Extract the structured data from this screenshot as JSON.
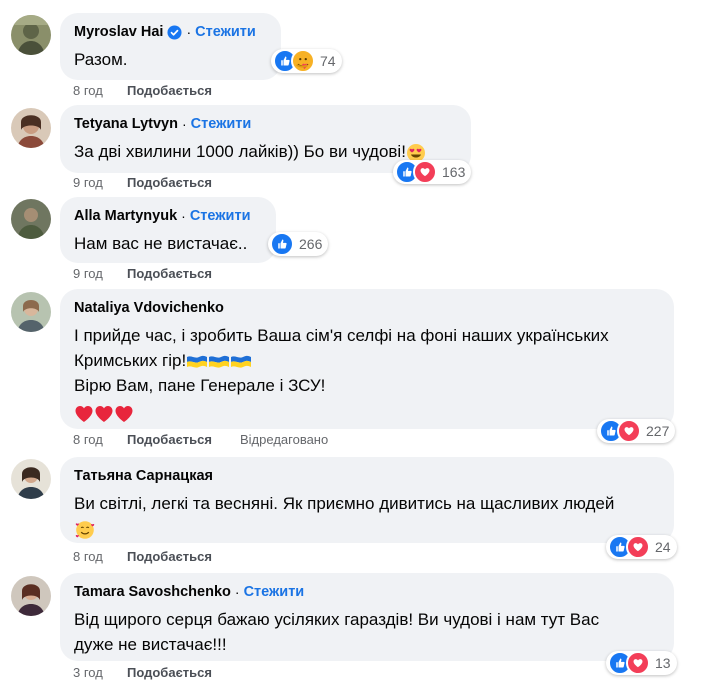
{
  "follow_label": "Стежити",
  "like_label": "Подобається",
  "comments": [
    {
      "author": "Myroslav Hai",
      "verified": true,
      "show_follow": true,
      "text": "Разом.",
      "time": "8 год",
      "reactions": [
        "like",
        "care"
      ],
      "reaction_count": "74"
    },
    {
      "author": "Tetyana Lytvyn",
      "verified": false,
      "show_follow": true,
      "text": "За дві хвилини 1000 лайків)) Бо ви чудові!",
      "trailing_emoji": "heart-eyes",
      "time": "9 год",
      "reactions": [
        "like",
        "love"
      ],
      "reaction_count": "163"
    },
    {
      "author": "Alla Martynyuk",
      "verified": false,
      "show_follow": true,
      "text": "Нам вас не вистачає..",
      "time": "9 год",
      "reactions": [
        "like"
      ],
      "reaction_count": "266"
    },
    {
      "author": "Nataliya Vdovichenko",
      "verified": false,
      "show_follow": false,
      "text_lines": [
        "І прийде час, і зробить Ваша сім'я селфі на фоні наших українських",
        "Кримських гір!",
        "Вірю Вам, пане Генерале і ЗСУ!"
      ],
      "flags": [
        "ukraine-flag",
        "ukraine-flag",
        "ukraine-flag"
      ],
      "hearts": [
        "red-heart",
        "red-heart",
        "red-heart"
      ],
      "time": "8 год",
      "edited": "Відредаговано",
      "reactions": [
        "like",
        "love"
      ],
      "reaction_count": "227"
    },
    {
      "author": "Татьяна Сарнацкая",
      "verified": false,
      "show_follow": false,
      "text": "Ви світлі, легкі та весняні. Як приємно дивитись на щасливих людей",
      "trailing_emoji": "smiling-face-with-hearts",
      "time": "8 год",
      "reactions": [
        "like",
        "love"
      ],
      "reaction_count": "24"
    },
    {
      "author": "Tamara Savoshchenko",
      "verified": false,
      "show_follow": true,
      "text_lines": [
        "Від щирого серця бажаю усіляких гараздів! Ви чудові і нам тут Вас",
        "дуже не вистачає!!!"
      ],
      "time": "3 год",
      "reactions": [
        "like",
        "love"
      ],
      "reaction_count": "13"
    }
  ],
  "colors": {
    "bubble": "#f0f2f5",
    "follow": "#1b74e4",
    "like_reaction": "#1877f2",
    "love_reaction": "#f33e58",
    "meta_text": "#65676b"
  }
}
